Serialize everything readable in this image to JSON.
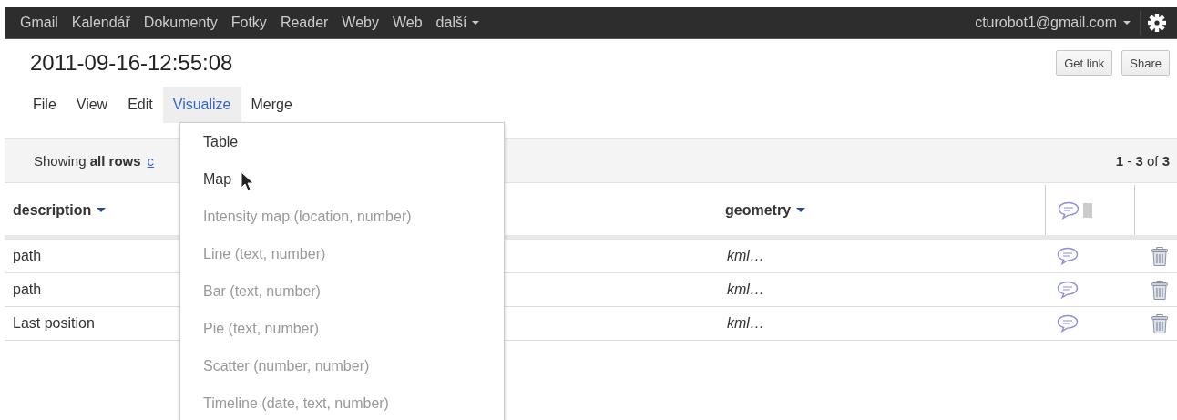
{
  "top_bar": {
    "links": [
      {
        "label": "Gmail"
      },
      {
        "label": "Kalendář"
      },
      {
        "label": "Dokumenty"
      },
      {
        "label": "Fotky"
      },
      {
        "label": "Reader"
      },
      {
        "label": "Weby"
      },
      {
        "label": "Web"
      },
      {
        "label": "další",
        "kind": "dropdown"
      }
    ],
    "account": "cturobot1@gmail.com"
  },
  "document": {
    "title": "2011-09-16-12:55:08",
    "buttons": [
      "Get link",
      "Share"
    ]
  },
  "menu_bar": [
    {
      "label": "File",
      "selected": false
    },
    {
      "label": "View",
      "selected": false
    },
    {
      "label": "Edit",
      "selected": false
    },
    {
      "label": "Visualize",
      "selected": true
    },
    {
      "label": "Merge",
      "selected": false
    }
  ],
  "filter_bar": {
    "text": "Showing **all rows**",
    "link": "c",
    "count": "**1** - **3** of **3**"
  },
  "table": {
    "columns": [
      {
        "label": "description"
      },
      {
        "label": "geometry"
      }
    ],
    "rows": [
      {
        "description": "path",
        "geometry": "kml…"
      },
      {
        "description": "path",
        "geometry": "kml…"
      },
      {
        "description": "Last position",
        "geometry": "kml…"
      }
    ]
  },
  "visualize_menu": [
    {
      "label": "Table",
      "disabled": false
    },
    {
      "label": "Map",
      "disabled": false
    },
    {
      "label": "Intensity map (location, number)",
      "disabled": true
    },
    {
      "label": "Line (text, number)",
      "disabled": true
    },
    {
      "label": "Bar (text, number)",
      "disabled": true
    },
    {
      "label": "Pie (text, number)",
      "disabled": true
    },
    {
      "label": "Scatter (number, number)",
      "disabled": true
    },
    {
      "label": "Timeline (date, text, number)",
      "disabled": true
    }
  ]
}
